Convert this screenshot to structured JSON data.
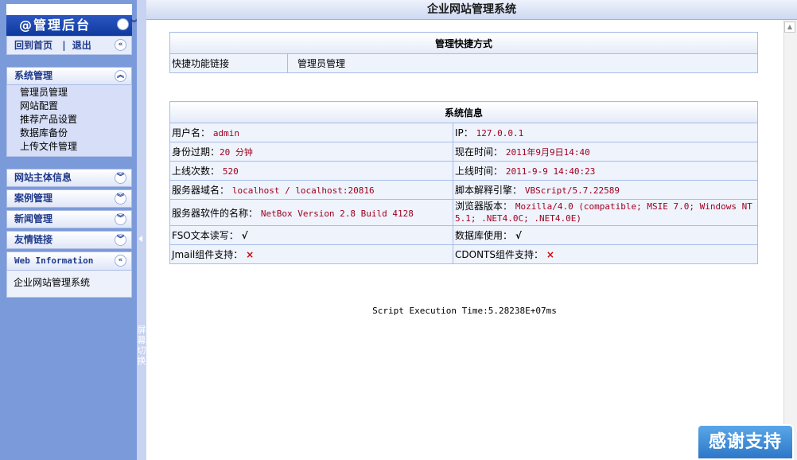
{
  "sidebar": {
    "admin_title": "@管理后台",
    "home_link": "回到首页",
    "separator": "|",
    "logout_link": "退出",
    "sections": {
      "system": {
        "title": "系统管理",
        "items": [
          "管理员管理",
          "网站配置",
          "推荐产品设置",
          "数据库备份",
          "上传文件管理"
        ]
      },
      "site_info": {
        "title": "网站主体信息"
      },
      "cases": {
        "title": "案例管理"
      },
      "news": {
        "title": "新闻管理"
      },
      "links": {
        "title": "友情链接"
      },
      "web_info": {
        "title": "Web Information",
        "body": "企业网站管理系统"
      }
    },
    "splitter_text": "屏幕切换"
  },
  "main": {
    "title": "企业网站管理系统",
    "shortcuts": {
      "header": "管理快捷方式",
      "label": "快捷功能链接",
      "link": "管理员管理"
    },
    "sysinfo": {
      "header": "系统信息",
      "rows": [
        {
          "l_label": "用户名：",
          "l_value": "admin",
          "r_label": "IP：",
          "r_value": "127.0.0.1"
        },
        {
          "l_label": "身份过期：",
          "l_value": "20 分钟",
          "r_label": "现在时间：",
          "r_value": "2011年9月9日14:40"
        },
        {
          "l_label": "上线次数：",
          "l_value": "520",
          "r_label": "上线时间：",
          "r_value": "2011-9-9 14:40:23"
        },
        {
          "l_label": "服务器域名：",
          "l_value": "localhost / localhost:20816",
          "r_label": "脚本解释引擎：",
          "r_value": "VBScript/5.7.22589"
        },
        {
          "l_label": "服务器软件的名称：",
          "l_value": "NetBox Version 2.8 Build 4128",
          "r_label": "浏览器版本：",
          "r_value": "Mozilla/4.0 (compatible; MSIE 7.0; Windows NT 5.1; .NET4.0C; .NET4.0E)"
        },
        {
          "l_label": "FSO文本读写：",
          "l_value": "√",
          "r_label": "数据库使用：",
          "r_value": "√"
        },
        {
          "l_label": "Jmail组件支持：",
          "l_value": "×",
          "r_label": "CDONTS组件支持：",
          "r_value": "×"
        }
      ]
    },
    "exec_time": "Script Execution Time:5.28238E+07ms"
  },
  "thanks_banner": "感谢支持",
  "icons": {
    "collapse": "chevrons-up-icon",
    "expand": "chevrons-down-icon",
    "back": "chevrons-left-icon"
  }
}
